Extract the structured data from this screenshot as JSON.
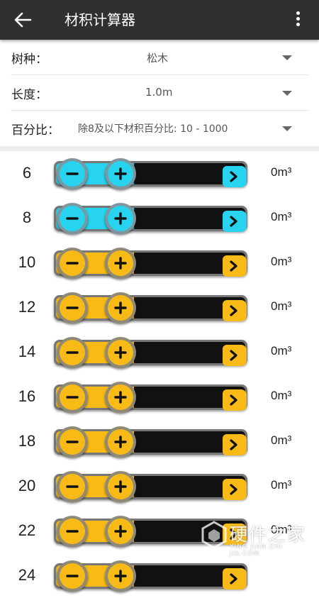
{
  "app_bar": {
    "title": "材积计算器",
    "back_icon": "arrow-left-icon",
    "menu_icon": "more-vert-icon"
  },
  "settings": {
    "species": {
      "label": "树种：",
      "value": "松木"
    },
    "length": {
      "label": "长度：",
      "value": "1.0m"
    },
    "percent": {
      "label": "百分比：",
      "value": "除8及以下材积百分比: 10 - 1000"
    }
  },
  "colors": {
    "app_bar": "#303030",
    "blue_accent": "#27d3ee",
    "yellow_accent": "#f8ba16"
  },
  "rows": [
    {
      "diameter": "6",
      "volume": "0m³",
      "color": "blue"
    },
    {
      "diameter": "8",
      "volume": "0m³",
      "color": "blue"
    },
    {
      "diameter": "10",
      "volume": "0m³",
      "color": "yellow"
    },
    {
      "diameter": "12",
      "volume": "0m³",
      "color": "yellow"
    },
    {
      "diameter": "14",
      "volume": "0m³",
      "color": "yellow"
    },
    {
      "diameter": "16",
      "volume": "0m³",
      "color": "yellow"
    },
    {
      "diameter": "18",
      "volume": "0m³",
      "color": "yellow"
    },
    {
      "diameter": "20",
      "volume": "0m³",
      "color": "yellow"
    },
    {
      "diameter": "22",
      "volume": "0m³",
      "color": "yellow"
    },
    {
      "diameter": "24",
      "volume": "",
      "color": "yellow"
    }
  ],
  "watermark": {
    "title": "硬件之家",
    "subtitle": "YING JIAN ZHI JIA.COM"
  }
}
